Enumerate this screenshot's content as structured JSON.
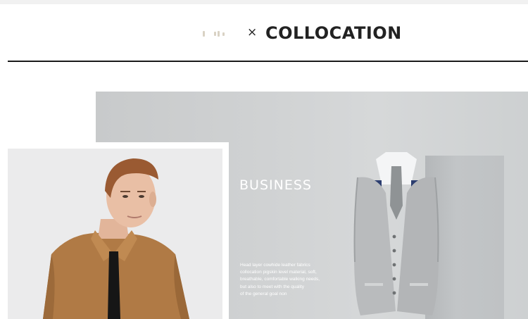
{
  "header": {
    "title": "COLLOCATION",
    "separator": "×"
  },
  "feature": {
    "section_title": "BUSINESS",
    "description_lines": [
      "Head layer cowhide leather fabrics",
      "collocation pigskin level material, soft,",
      "breathable, comfortable walking needs,",
      "but also to meet with the quality",
      " of the general goal non"
    ]
  },
  "colors": {
    "panel_background": "#cfd1d2",
    "title_text": "#222222",
    "rule": "#1a1a1a",
    "shirt": "#b07a45",
    "vest": "#b9bbbd"
  },
  "icons": {
    "brand_logo": "brand-logo-icon"
  }
}
